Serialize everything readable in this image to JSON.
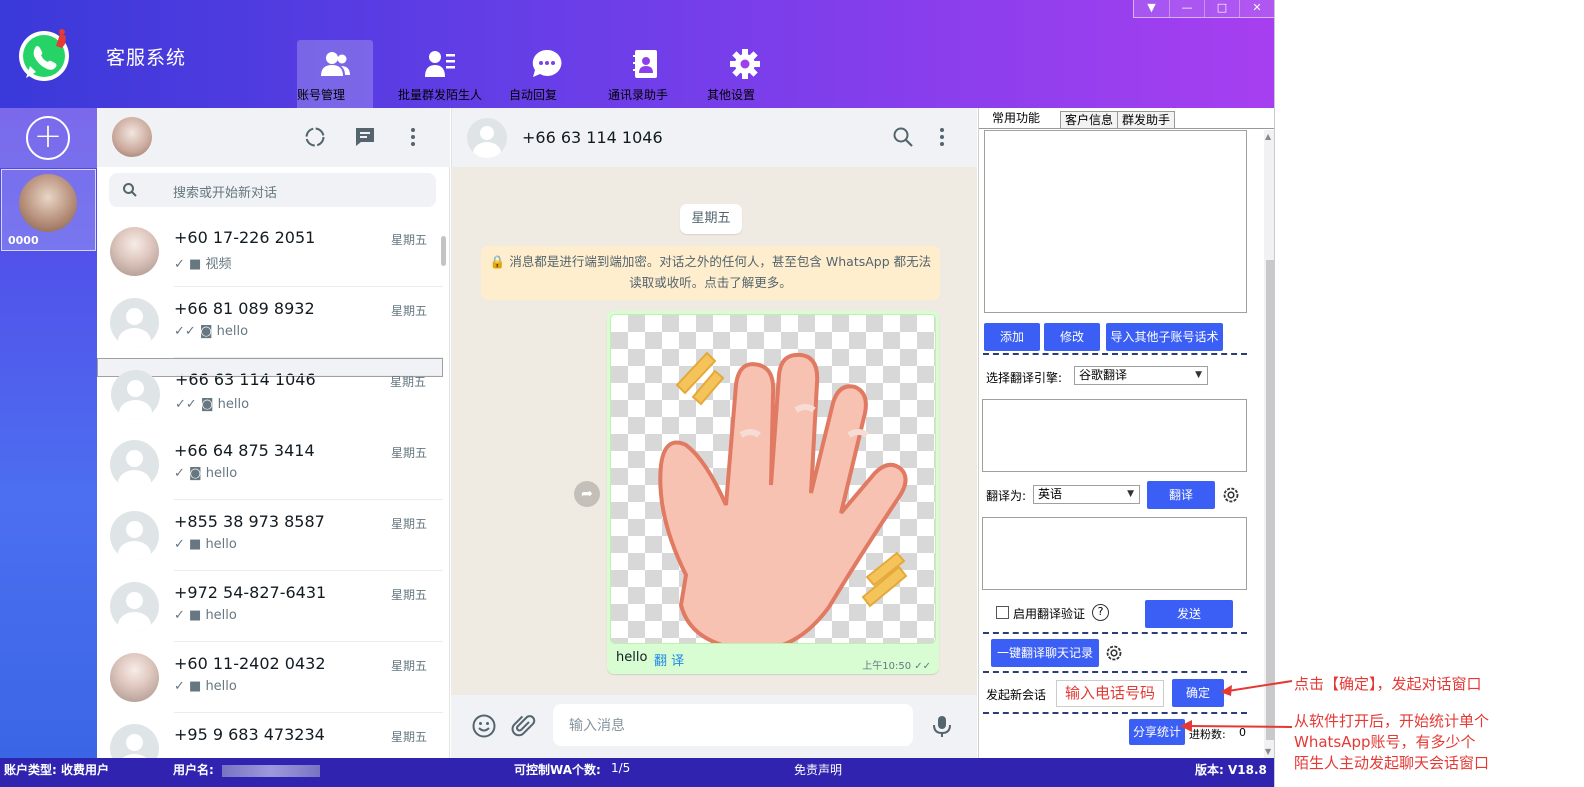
{
  "app": {
    "title": "客服系统",
    "window_controls": [
      "▼",
      "—",
      "□",
      "✕"
    ]
  },
  "nav": {
    "tabs": [
      {
        "label": "账号管理",
        "icon": "users-icon",
        "active": true
      },
      {
        "label": "批量群发陌生人",
        "icon": "user-list-icon",
        "active": false
      },
      {
        "label": "自动回复",
        "icon": "chat-bubble-icon",
        "active": false
      },
      {
        "label": "通讯录助手",
        "icon": "contacts-book-icon",
        "active": false
      },
      {
        "label": "其他设置",
        "icon": "gear-icon",
        "active": false
      }
    ]
  },
  "accounts": {
    "add_symbol": "+",
    "items": [
      {
        "name": "0000"
      }
    ]
  },
  "chat_list": {
    "search_placeholder": "搜索或开始新对话",
    "chats": [
      {
        "name": "+60 17-226 2051",
        "date": "星期五",
        "preview": "✓ ■ 视频",
        "avatar": "photo"
      },
      {
        "name": "+66 81 089 8932",
        "date": "星期五",
        "preview": "✓✓ ◙ hello",
        "avatar": "default"
      },
      {
        "name": "+66 63 114 1046",
        "date": "星期五",
        "preview": "✓✓ ◙ hello",
        "avatar": "default",
        "selected": true
      },
      {
        "name": "+66 64 875 3414",
        "date": "星期五",
        "preview": "✓ ◙ hello",
        "avatar": "default"
      },
      {
        "name": "+855 38 973 8587",
        "date": "星期五",
        "preview": "✓ ■ hello",
        "avatar": "default"
      },
      {
        "name": "+972 54-827-6431",
        "date": "星期五",
        "preview": "✓ ■ hello",
        "avatar": "default"
      },
      {
        "name": "+60 11-2402 0432",
        "date": "星期五",
        "preview": "✓ ■ hello",
        "avatar": "photo"
      },
      {
        "name": "+95 9 683 473234",
        "date": "星期五",
        "preview": "",
        "avatar": "default"
      }
    ]
  },
  "conversation": {
    "contact": "+66 63 114 1046",
    "day_chip": "星期五",
    "encryption_note_line1": "🔒 消息都是进行端到端加密。对话之外的任何人，甚至包含 WhatsApp 都无法",
    "encryption_note_line2": "读取或收听。点击了解更多。",
    "message": {
      "caption": "hello",
      "translate": "翻 译",
      "time": "上午10:50 ✓✓"
    },
    "input_placeholder": "输入消息"
  },
  "right_panel": {
    "tabs": [
      "常用功能",
      "客户信息",
      "群发助手"
    ],
    "buttons": {
      "add": "添加",
      "edit": "修改",
      "import": "导入其他子账号话术",
      "translate": "翻译",
      "send": "发送",
      "translate_history": "一键翻译聊天记录",
      "confirm": "确定",
      "share_stats": "分享统计"
    },
    "engine_label": "选择翻译引擎:",
    "engine_value": "谷歌翻译",
    "target_label": "翻译为:",
    "target_value": "英语",
    "verify_label": "启用翻译验证",
    "help_symbol": "?",
    "new_chat_label": "发起新会话",
    "phone_placeholder": "输入电话号码",
    "fans_label": "进粉数:",
    "fans_value": "0"
  },
  "status_bar": {
    "account_type": "账户类型: 收费用户",
    "username_label": "用户名:",
    "controllable": "可控制WA个数:",
    "controllable_value": "1/5",
    "disclaimer": "免责声明",
    "version": "版本: V18.8"
  },
  "annotations": {
    "confirm_note": "点击【确定】，发起对话窗口",
    "stats_note_line1": "从软件打开后，开始统计单个",
    "stats_note_line2": "WhatsApp账号，有多少个",
    "stats_note_line3": "陌生人主动发起聊天会话窗口"
  },
  "colors": {
    "header_gradient_start": "#3a39d9",
    "header_gradient_end": "#a73ff0",
    "primary_button": "#3b5ff5",
    "annotation_red": "#e53935",
    "status_bar": "#2f23b0",
    "chat_bubble": "#d9fdd3"
  }
}
